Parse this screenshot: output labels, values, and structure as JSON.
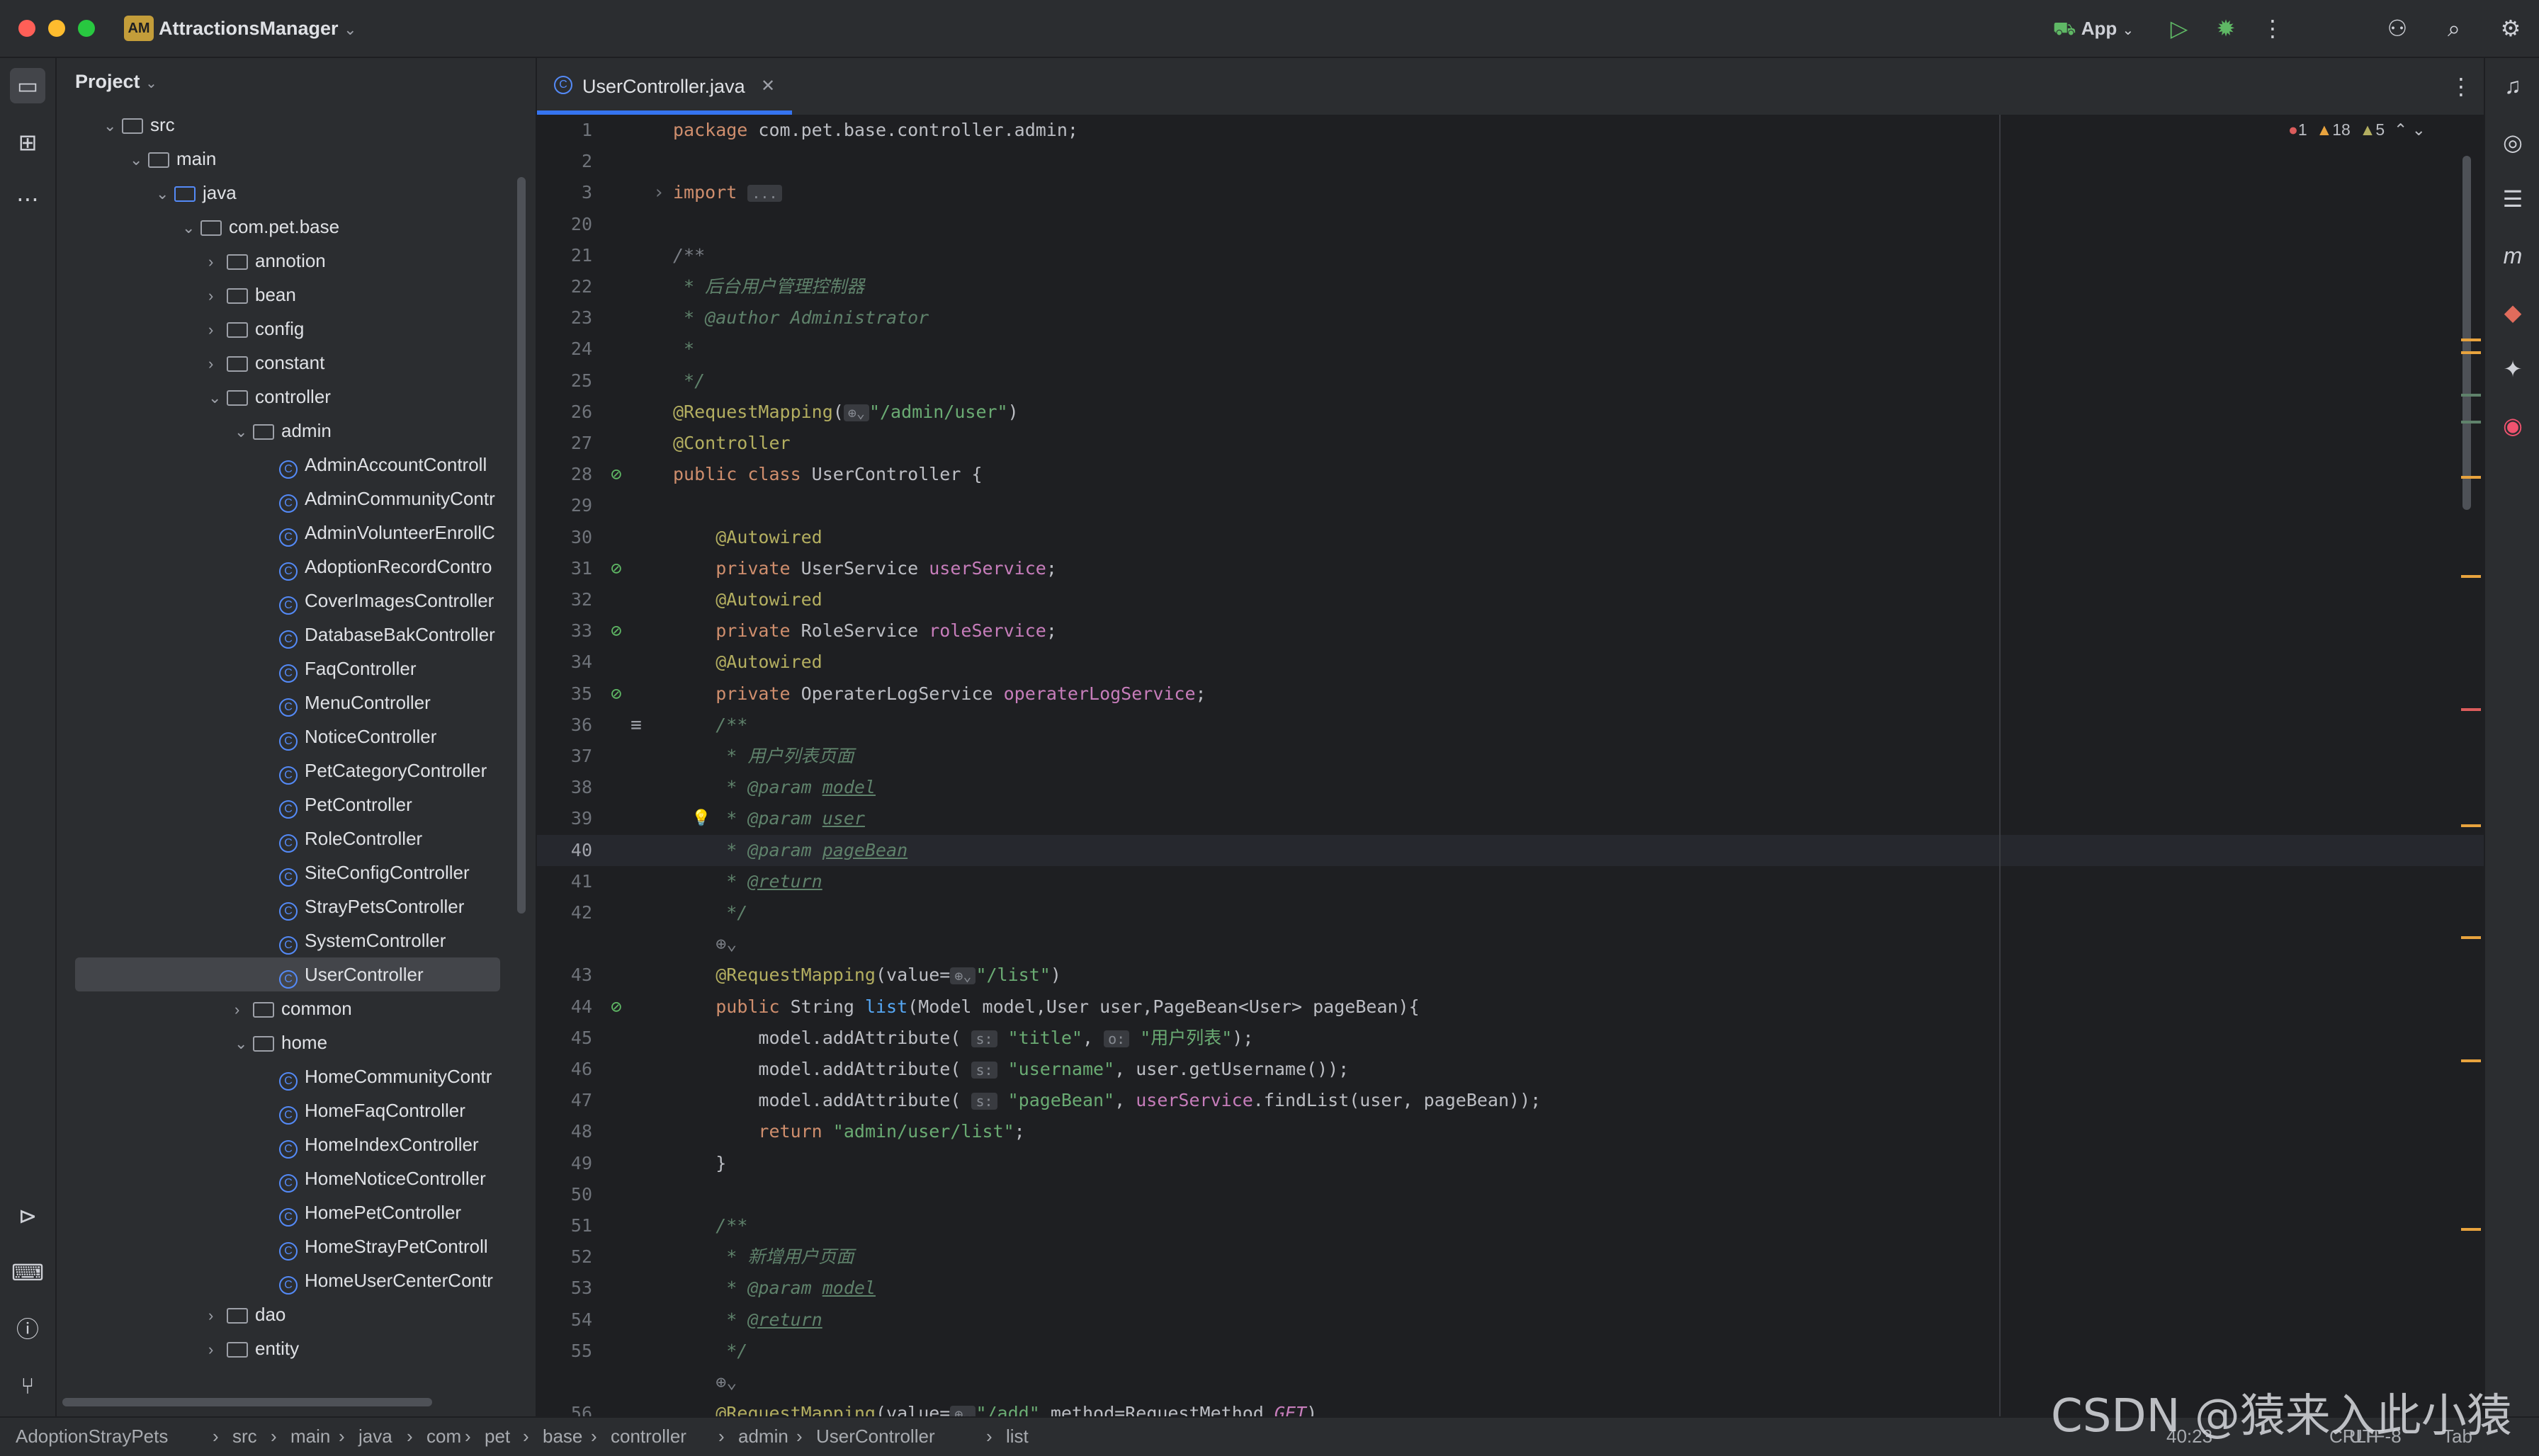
{
  "window": {
    "project_badge": "AM",
    "project_name": "AttractionsManager",
    "run_config": "App"
  },
  "project_panel": {
    "header": "Project",
    "tree": [
      {
        "label": "src",
        "kind": "folder",
        "depth": 1,
        "expanded": true
      },
      {
        "label": "main",
        "kind": "folder",
        "depth": 2,
        "expanded": true
      },
      {
        "label": "java",
        "kind": "folder",
        "depth": 3,
        "expanded": true
      },
      {
        "label": "com.pet.base",
        "kind": "package",
        "depth": 4,
        "expanded": true
      },
      {
        "label": "annotion",
        "kind": "package",
        "depth": 5,
        "expanded": false
      },
      {
        "label": "bean",
        "kind": "package",
        "depth": 5,
        "expanded": false
      },
      {
        "label": "config",
        "kind": "package",
        "depth": 5,
        "expanded": false
      },
      {
        "label": "constant",
        "kind": "package",
        "depth": 5,
        "expanded": false
      },
      {
        "label": "controller",
        "kind": "package",
        "depth": 5,
        "expanded": true
      },
      {
        "label": "admin",
        "kind": "package",
        "depth": 6,
        "expanded": true
      },
      {
        "label": "AdminAccountControll",
        "kind": "class",
        "depth": 7
      },
      {
        "label": "AdminCommunityContr",
        "kind": "class",
        "depth": 7
      },
      {
        "label": "AdminVolunteerEnrollC",
        "kind": "class",
        "depth": 7
      },
      {
        "label": "AdoptionRecordContro",
        "kind": "class",
        "depth": 7
      },
      {
        "label": "CoverImagesController",
        "kind": "class",
        "depth": 7
      },
      {
        "label": "DatabaseBakController",
        "kind": "class",
        "depth": 7
      },
      {
        "label": "FaqController",
        "kind": "class",
        "depth": 7
      },
      {
        "label": "MenuController",
        "kind": "class",
        "depth": 7
      },
      {
        "label": "NoticeController",
        "kind": "class",
        "depth": 7
      },
      {
        "label": "PetCategoryController",
        "kind": "class",
        "depth": 7
      },
      {
        "label": "PetController",
        "kind": "class",
        "depth": 7
      },
      {
        "label": "RoleController",
        "kind": "class",
        "depth": 7
      },
      {
        "label": "SiteConfigController",
        "kind": "class",
        "depth": 7
      },
      {
        "label": "StrayPetsController",
        "kind": "class",
        "depth": 7
      },
      {
        "label": "SystemController",
        "kind": "class",
        "depth": 7
      },
      {
        "label": "UserController",
        "kind": "class",
        "depth": 7,
        "selected": true
      },
      {
        "label": "common",
        "kind": "package",
        "depth": 6,
        "expanded": false
      },
      {
        "label": "home",
        "kind": "package",
        "depth": 6,
        "expanded": true
      },
      {
        "label": "HomeCommunityContr",
        "kind": "class",
        "depth": 7
      },
      {
        "label": "HomeFaqController",
        "kind": "class",
        "depth": 7
      },
      {
        "label": "HomeIndexController",
        "kind": "class",
        "depth": 7
      },
      {
        "label": "HomeNoticeController",
        "kind": "class",
        "depth": 7
      },
      {
        "label": "HomePetController",
        "kind": "class",
        "depth": 7
      },
      {
        "label": "HomeStrayPetControll",
        "kind": "class",
        "depth": 7
      },
      {
        "label": "HomeUserCenterContr",
        "kind": "class",
        "depth": 7
      },
      {
        "label": "dao",
        "kind": "package",
        "depth": 5,
        "expanded": false
      },
      {
        "label": "entity",
        "kind": "package",
        "depth": 5,
        "expanded": false
      }
    ]
  },
  "editor": {
    "tab_label": "UserController.java",
    "inspections": {
      "errors": "1",
      "warnings": "18",
      "weak_warnings": "5"
    },
    "current_line": "40",
    "lines": [
      {
        "n": "1",
        "html": "<span class=\"kw\">package</span> com.pet.base.controller.admin;"
      },
      {
        "n": "2",
        "html": ""
      },
      {
        "n": "3",
        "html": "<span class=\"kw\">import</span> <span class=\"hint\">...</span>"
      },
      {
        "n": "20",
        "html": ""
      },
      {
        "n": "21",
        "html": "<span class=\"cmt\">/**</span>"
      },
      {
        "n": "22",
        "html": "<span class=\"doc\"> * 后台用户管理控制器</span>"
      },
      {
        "n": "23",
        "html": "<span class=\"doc\"> * <i>@author</i> Administrator</span>"
      },
      {
        "n": "24",
        "html": "<span class=\"doc\"> *</span>"
      },
      {
        "n": "25",
        "html": "<span class=\"doc\"> */</span>"
      },
      {
        "n": "26",
        "html": "<span class=\"ann\">@RequestMapping</span>(<span class=\"hint\">⊕⌄</span><span class=\"str\">\"/admin/user\"</span>)"
      },
      {
        "n": "27",
        "html": "<span class=\"ann\">@Controller</span>"
      },
      {
        "n": "28",
        "html": "<span class=\"kw\">public class</span> UserController {"
      },
      {
        "n": "29",
        "html": ""
      },
      {
        "n": "30",
        "html": "    <span class=\"ann\">@Autowired</span>"
      },
      {
        "n": "31",
        "html": "    <span class=\"kw\">private</span> UserService <span class=\"field\">userService</span>;"
      },
      {
        "n": "32",
        "html": "    <span class=\"ann\">@Autowired</span>"
      },
      {
        "n": "33",
        "html": "    <span class=\"kw\">private</span> RoleService <span class=\"field\">roleService</span>;"
      },
      {
        "n": "34",
        "html": "    <span class=\"ann\">@Autowired</span>"
      },
      {
        "n": "35",
        "html": "    <span class=\"kw\">private</span> OperaterLogService <span class=\"field\">operaterLogService</span>;"
      },
      {
        "n": "36",
        "html": "    <span class=\"doc\">/**</span>"
      },
      {
        "n": "37",
        "html": "<span class=\"doc\">     * 用户列表页面</span>"
      },
      {
        "n": "38",
        "html": "<span class=\"doc\">     * @param <u>model</u></span>"
      },
      {
        "n": "39",
        "html": "<span class=\"doc\">     * @param <u>user</u></span>"
      },
      {
        "n": "40",
        "html": "<span class=\"doc\">     * @param <u>pageBean</u></span>"
      },
      {
        "n": "41",
        "html": "<span class=\"doc\">     * <u>@return</u></span>"
      },
      {
        "n": "42",
        "html": "<span class=\"doc\">     */</span>"
      },
      {
        "n": "",
        "html": "    <span class=\"cmt\">⊕⌄</span>"
      },
      {
        "n": "43",
        "html": "    <span class=\"ann\">@RequestMapping</span>(value=<span class=\"hint\">⊕⌄</span><span class=\"str\">\"/list\"</span>)"
      },
      {
        "n": "44",
        "html": "    <span class=\"kw\">public</span> String <span style=\"color:#56a8f5\">list</span>(Model model,User user,PageBean&lt;User&gt; pageBean){"
      },
      {
        "n": "45",
        "html": "        model.addAttribute( <span class=\"hint\">s:</span> <span class=\"str\">\"title\"</span>, <span class=\"hint\">o:</span> <span class=\"str\">\"用户列表\"</span>);"
      },
      {
        "n": "46",
        "html": "        model.addAttribute( <span class=\"hint\">s:</span> <span class=\"str\">\"username\"</span>, user.getUsername());"
      },
      {
        "n": "47",
        "html": "        model.addAttribute( <span class=\"hint\">s:</span> <span class=\"str\">\"pageBean\"</span>, <span class=\"field\">userService</span>.findList(user, pageBean));"
      },
      {
        "n": "48",
        "html": "        <span class=\"kw\">return</span> <span class=\"str\">\"admin/user/list\"</span>;"
      },
      {
        "n": "49",
        "html": "    }"
      },
      {
        "n": "50",
        "html": ""
      },
      {
        "n": "51",
        "html": "    <span class=\"doc\">/**</span>"
      },
      {
        "n": "52",
        "html": "<span class=\"doc\">     * 新增用户页面</span>"
      },
      {
        "n": "53",
        "html": "<span class=\"doc\">     * @param <u>model</u></span>"
      },
      {
        "n": "54",
        "html": "<span class=\"doc\">     * <u>@return</u></span>"
      },
      {
        "n": "55",
        "html": "<span class=\"doc\">     */</span>"
      },
      {
        "n": "",
        "html": "    <span class=\"cmt\">⊕⌄</span>"
      },
      {
        "n": "56",
        "html": "    <span class=\"ann\">@RequestMapping</span>(value=<span class=\"hint\">⊕⌄</span><span class=\"str\">\"/add\"</span>,method=RequestMethod.<i style=\"color:#c77dbb\">GET</i>)"
      }
    ]
  },
  "statusbar": {
    "breadcrumbs": [
      "AdoptionStrayPets",
      "src",
      "main",
      "java",
      "com",
      "pet",
      "base",
      "controller",
      "admin",
      "UserController",
      "list"
    ],
    "position": "40:23",
    "line_sep": "CRLF",
    "encoding": "UTF-8",
    "indent": "Tab"
  },
  "watermark": "CSDN @猿来入此小猿",
  "colors": {
    "accent": "#3574f0",
    "error": "#db5c5c",
    "warning": "#e8a33e"
  }
}
